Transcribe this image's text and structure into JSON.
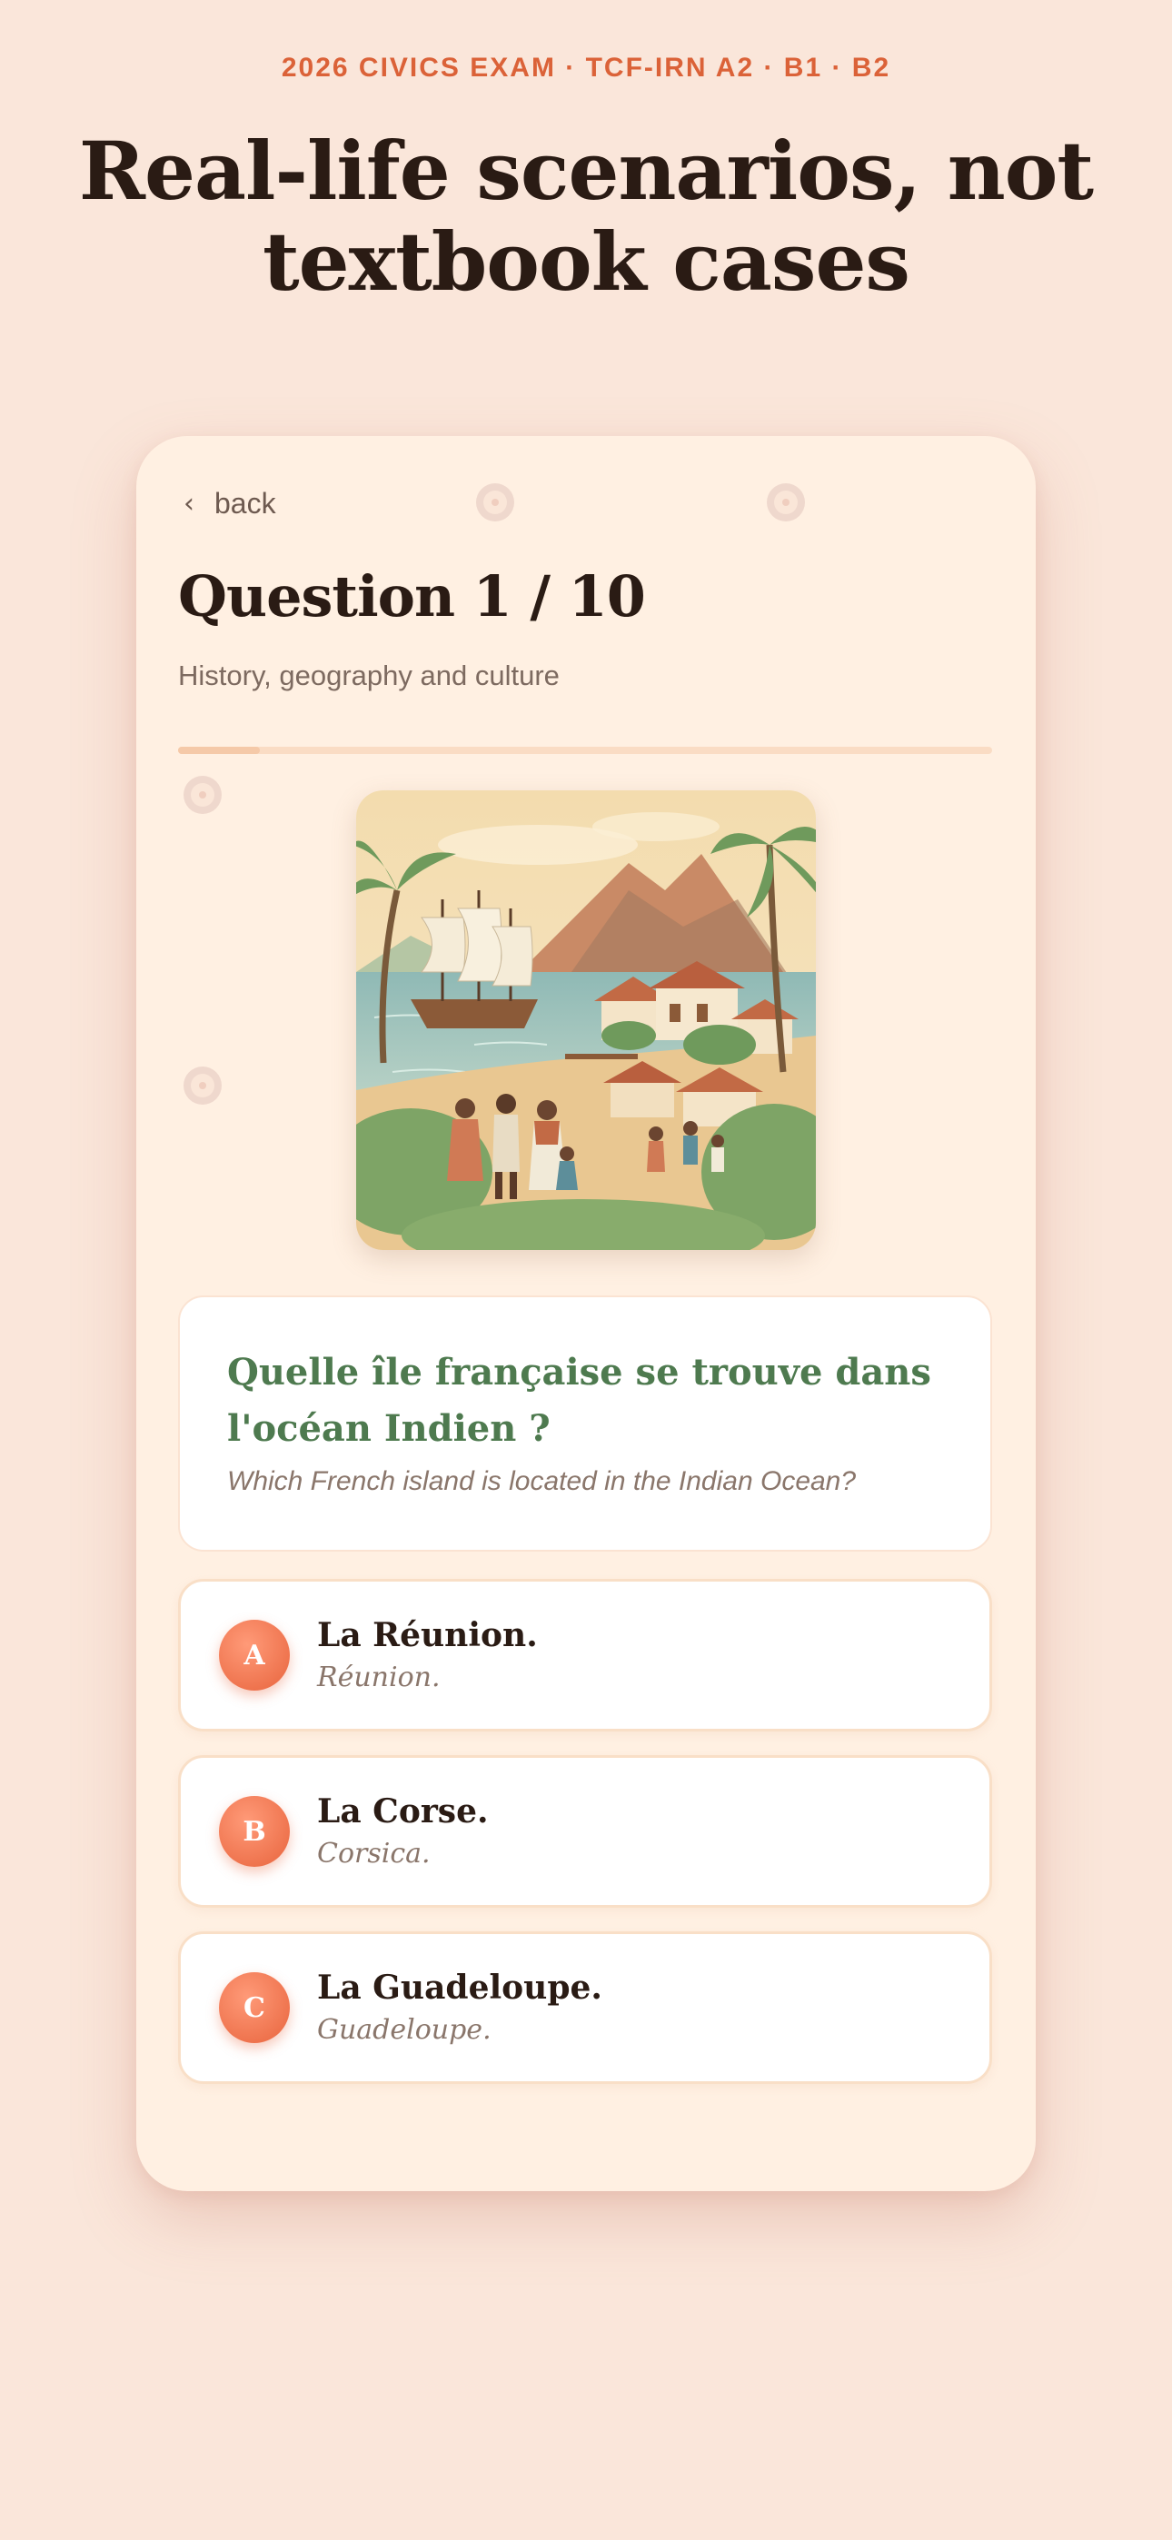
{
  "header": {
    "eyebrow": "2026 CIVICS EXAM · TCF-IRN A2 · B1 · B2",
    "headline": "Real-life scenarios, not textbook cases"
  },
  "quiz": {
    "back_label": "back",
    "question_title": "Question 1 / 10",
    "category": "History, geography and culture",
    "progress": 0.1,
    "illustration_icon": "tropical-island-illustration",
    "question_fr": "Quelle île française se trouve dans l'océan Indien ?",
    "question_en": "Which French island is located in the Indian Ocean?",
    "answers": [
      {
        "letter": "A",
        "fr": "La Réunion.",
        "en": "Réunion."
      },
      {
        "letter": "B",
        "fr": "La Corse.",
        "en": "Corsica."
      },
      {
        "letter": "C",
        "fr": "La Guadeloupe.",
        "en": "Guadeloupe."
      }
    ]
  },
  "colors": {
    "background": "#fae6da",
    "accent": "#db6238",
    "question_green": "#4e7a4f",
    "badge": "#e8643d"
  }
}
